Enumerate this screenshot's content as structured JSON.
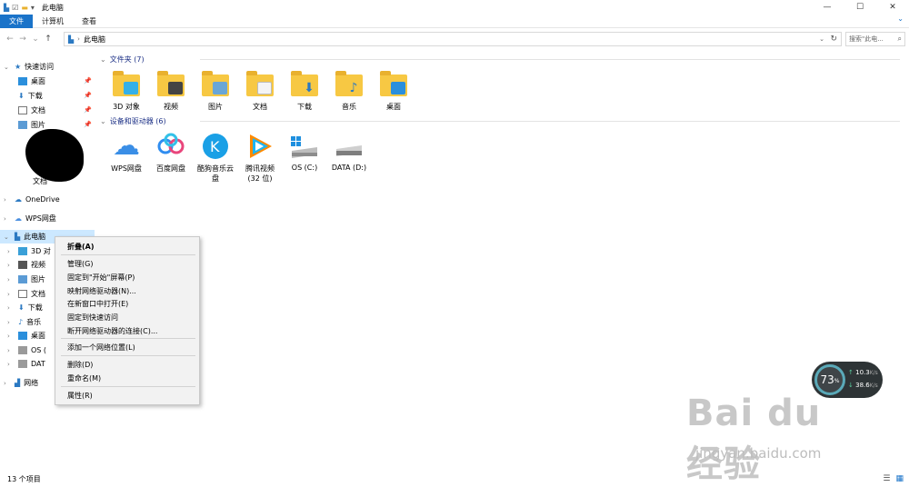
{
  "window": {
    "title": "此电脑",
    "minimize": "—",
    "maximize": "☐",
    "close": "✕"
  },
  "ribbon": {
    "tabs": [
      "文件",
      "计算机",
      "查看"
    ],
    "expand": "⌄"
  },
  "address": {
    "path": "此电脑",
    "search_placeholder": "搜索\"此电...",
    "back": "←",
    "forward": "→",
    "recent": "⌄",
    "up": "↑",
    "refresh": "↻",
    "dropdown": "⌄"
  },
  "sidebar": {
    "quick_access": "快速访问",
    "quick_items": [
      "桌面",
      "下载",
      "文档",
      "图片"
    ],
    "partial_items": [
      "文档"
    ],
    "onedrive": "OneDrive",
    "wps": "WPS网盘",
    "this_pc": "此电脑",
    "pc_items": [
      "3D 对",
      "视频",
      "图片",
      "文档",
      "下载",
      "音乐",
      "桌面",
      "OS (",
      "DAT"
    ],
    "network": "网络"
  },
  "folders_group": {
    "header": "文件夹 (7)",
    "items": [
      "3D 对象",
      "视频",
      "图片",
      "文档",
      "下载",
      "音乐",
      "桌面"
    ]
  },
  "devices_group": {
    "header": "设备和驱动器 (6)",
    "items": [
      "WPS网盘",
      "百度网盘",
      "酷狗音乐云盘",
      "腾讯视频 (32 位)",
      "OS (C:)",
      "DATA (D:)"
    ]
  },
  "context_menu": {
    "items": [
      "折叠(A)",
      "管理(G)",
      "固定到\"开始\"屏幕(P)",
      "映射网络驱动器(N)...",
      "在新窗口中打开(E)",
      "固定到快速访问",
      "断开网络驱动器的连接(C)...",
      "添加一个网络位置(L)",
      "删除(D)",
      "重命名(M)",
      "属性(R)"
    ]
  },
  "status": {
    "count": "13 个项目"
  },
  "net_widget": {
    "percent": "73",
    "unit": "%",
    "up": "10.3",
    "down": "38.6",
    "rate_unit": "K/s"
  },
  "watermark": {
    "logo": "Bai du 经验",
    "url": "jingyan.baidu.com"
  },
  "colors": {
    "accent": "#1a73c9",
    "folder": "#f7c843"
  }
}
